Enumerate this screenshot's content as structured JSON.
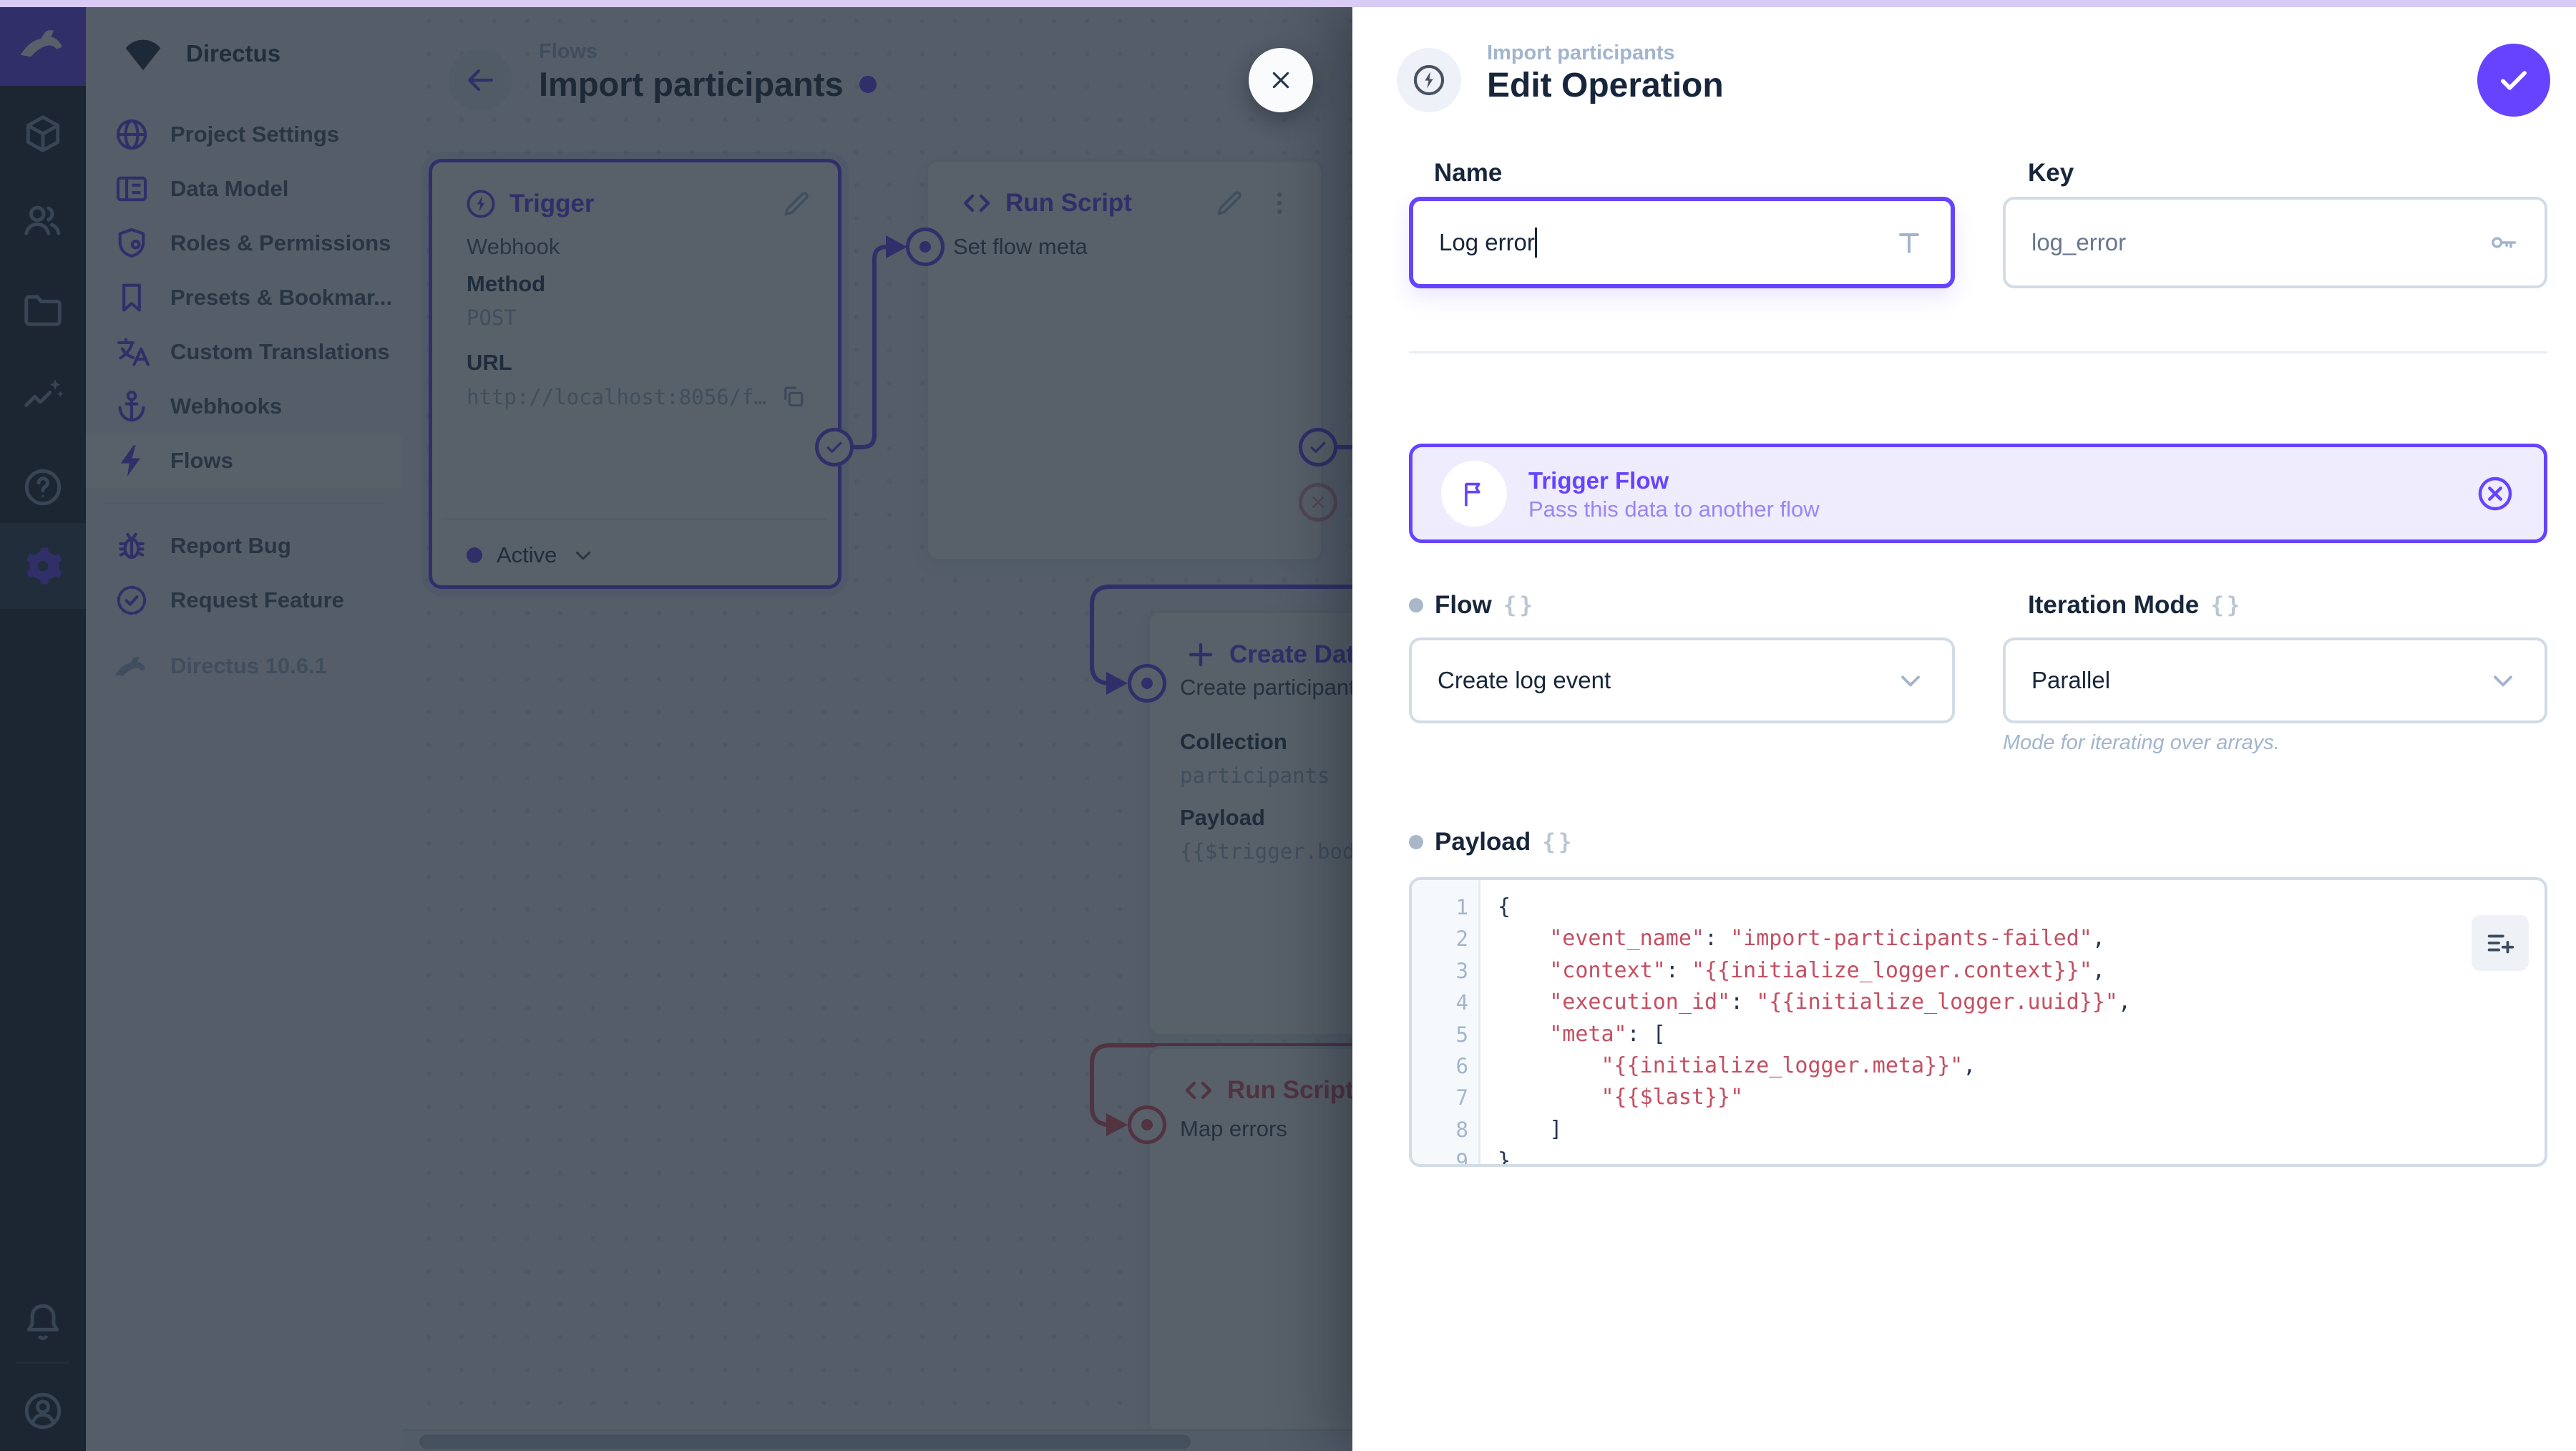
{
  "colors": {
    "accent": "#6644ff",
    "danger": "#e35169",
    "code_string": "#c44f62",
    "code_punct": "#26364d",
    "top_strip": "#d8cbf4"
  },
  "icons": {
    "braces_glyph": "{}"
  },
  "module_bar": {
    "items": [
      {
        "icon": "cube",
        "name": "content-module",
        "active": false
      },
      {
        "icon": "users",
        "name": "users-module",
        "active": false
      },
      {
        "icon": "folder",
        "name": "files-module",
        "active": false
      },
      {
        "icon": "insights",
        "name": "insights-module",
        "active": false
      },
      {
        "icon": "help",
        "name": "docs-module",
        "active": false
      },
      {
        "icon": "gear",
        "name": "settings-module",
        "active": true
      }
    ],
    "bottom": [
      {
        "icon": "bell",
        "name": "notifications-button"
      },
      {
        "icon": "user-circle",
        "name": "account-button"
      }
    ]
  },
  "nav": {
    "project_name": "Directus",
    "items": [
      {
        "icon": "globe",
        "label": "Project Settings"
      },
      {
        "icon": "data-model",
        "label": "Data Model"
      },
      {
        "icon": "shield",
        "label": "Roles & Permissions"
      },
      {
        "icon": "bookmark",
        "label": "Presets & Bookmar..."
      },
      {
        "icon": "translate",
        "label": "Custom Translations"
      },
      {
        "icon": "anchor",
        "label": "Webhooks"
      },
      {
        "icon": "bolt",
        "label": "Flows",
        "active": true
      }
    ],
    "footer_items": [
      {
        "icon": "bug",
        "label": "Report Bug"
      },
      {
        "icon": "seal-check",
        "label": "Request Feature"
      }
    ],
    "version": "Directus 10.6.1"
  },
  "canvas": {
    "breadcrumb": "Flows",
    "title": "Import participants",
    "trigger": {
      "title": "Trigger",
      "type": "Webhook",
      "method_label": "Method",
      "method": "POST",
      "url_label": "URL",
      "url": "http://localhost:8056/f…",
      "status": "Active"
    },
    "run_script": {
      "title": "Run Script",
      "name": "Set flow meta"
    },
    "create_data": {
      "title": "Create Data",
      "name": "Create participant",
      "collection_label": "Collection",
      "collection": "participants",
      "payload_label": "Payload",
      "payload_preview": "{{$trigger.bod"
    },
    "map_errors": {
      "title": "Run Script",
      "name": "Map errors"
    }
  },
  "drawer": {
    "breadcrumb": "Import participants",
    "title": "Edit Operation",
    "name_field": {
      "label": "Name",
      "value": "Log error"
    },
    "key_field": {
      "label": "Key",
      "value": "log_error"
    },
    "banner": {
      "title": "Trigger Flow",
      "subtitle": "Pass this data to another flow"
    },
    "flow_field": {
      "label": "Flow",
      "value": "Create log event"
    },
    "iteration_field": {
      "label": "Iteration Mode",
      "value": "Parallel",
      "note": "Mode for iterating over arrays."
    },
    "payload_field": {
      "label": "Payload",
      "code_lines": [
        "{",
        "    \"event_name\": \"import-participants-failed\",",
        "    \"context\": \"{{initialize_logger.context}}\",",
        "    \"execution_id\": \"{{initialize_logger.uuid}}\",",
        "    \"meta\": [",
        "        \"{{initialize_logger.meta}}\",",
        "        \"{{$last}}\"",
        "    ]",
        "}"
      ]
    }
  }
}
